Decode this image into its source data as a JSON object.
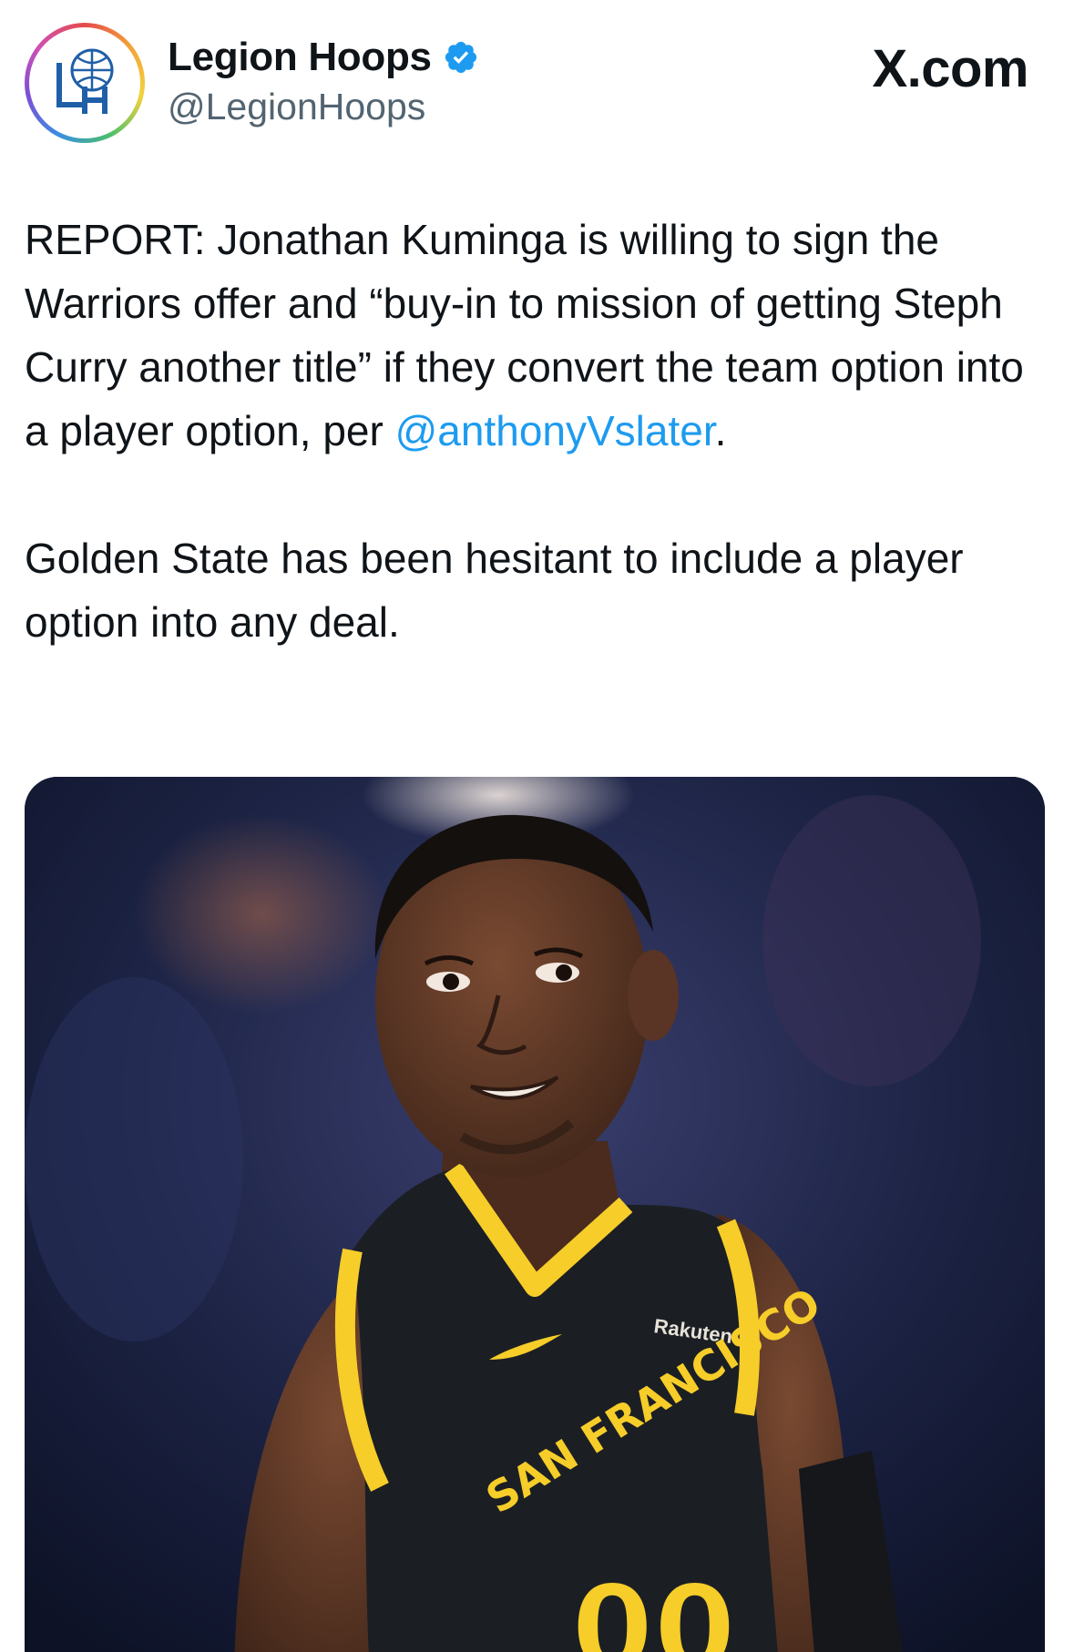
{
  "account": {
    "name": "Legion Hoops",
    "handle": "@LegionHoops",
    "verified": true,
    "avatar_logo_text": "LH",
    "verified_color": "#1d9bf0"
  },
  "brand": {
    "label": "X.com"
  },
  "tweet": {
    "paragraph1_text": "REPORT: Jonathan Kuminga is willing to sign the Warriors offer and “buy-in to mission of getting Steph Curry another title” if they convert the team option into a player option, per ",
    "mention": "@anthonyVslater",
    "paragraph1_end": ".",
    "paragraph2_text": "Golden State has been hesitant to include a player option into any deal.",
    "mention_color": "#1d9bf0"
  },
  "media": {
    "jersey_city": "SAN FRANCISCO",
    "jersey_number": "00",
    "jersey_sponsor": "Rakuten",
    "jersey_color": "#1b1f24",
    "trim_color": "#f6cd29"
  }
}
